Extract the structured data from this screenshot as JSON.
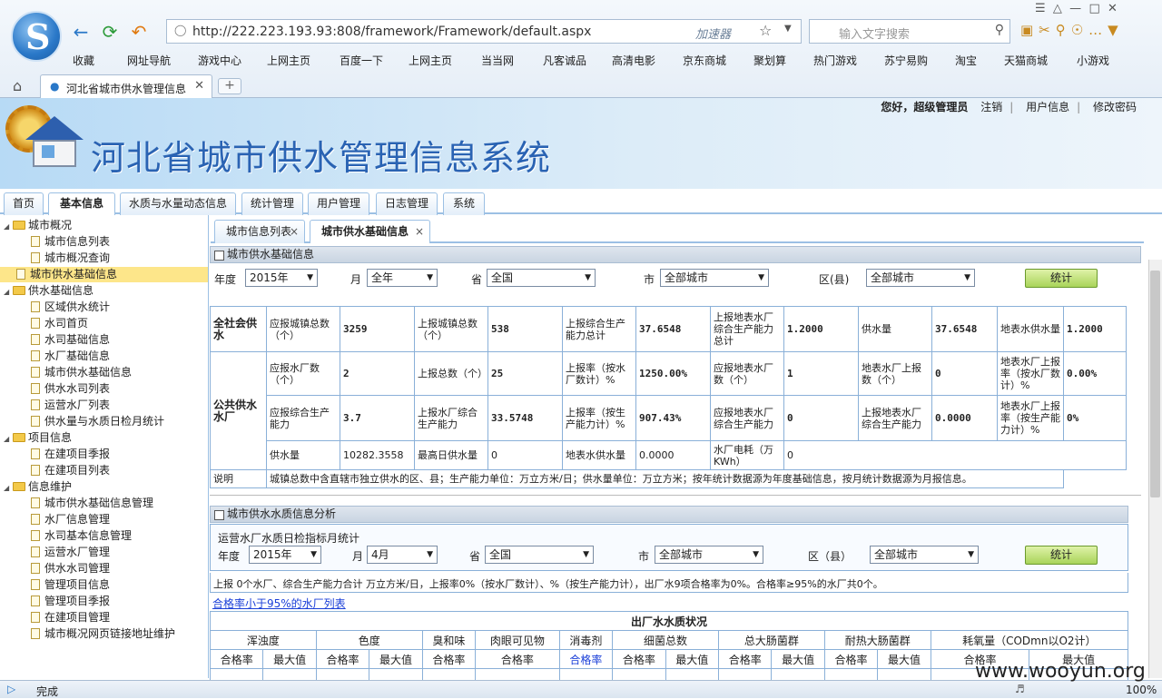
{
  "browser": {
    "url": "http://222.223.193.93:808/framework/Framework/default.aspx",
    "accelerator": "加速器",
    "search_placeholder": "输入文字搜索",
    "tab_title": "河北省城市供水管理信息",
    "status": "完成",
    "zoom": "100%"
  },
  "bookmarks": [
    "收藏",
    "网址导航",
    "游戏中心",
    "上网主页",
    "百度一下",
    "上网主页",
    "当当网",
    "凡客诚品",
    "高清电影",
    "京东商城",
    "聚划算",
    "热门游戏",
    "苏宁易购",
    "淘宝",
    "天猫商城",
    "小游戏"
  ],
  "app": {
    "title": "河北省城市供水管理信息系统",
    "greeting": "您好，超级管理员",
    "logout": "注销",
    "user_info": "用户信息",
    "change_pwd": "修改密码"
  },
  "main_tabs": [
    "首页",
    "基本信息",
    "水质与水量动态信息",
    "统计管理",
    "用户管理",
    "日志管理",
    "系统"
  ],
  "tree": [
    {
      "label": "城市概况",
      "lvl": 0,
      "type": "folder"
    },
    {
      "label": "城市信息列表",
      "lvl": 1,
      "type": "doc"
    },
    {
      "label": "城市概况查询",
      "lvl": 1,
      "type": "doc"
    },
    {
      "label": "城市供水基础信息",
      "lvl": 0,
      "type": "doc",
      "selected": true
    },
    {
      "label": "供水基础信息",
      "lvl": 0,
      "type": "folder"
    },
    {
      "label": "区域供水统计",
      "lvl": 1,
      "type": "doc"
    },
    {
      "label": "水司首页",
      "lvl": 1,
      "type": "doc"
    },
    {
      "label": "水司基础信息",
      "lvl": 1,
      "type": "doc"
    },
    {
      "label": "水厂基础信息",
      "lvl": 1,
      "type": "doc"
    },
    {
      "label": "城市供水基础信息",
      "lvl": 1,
      "type": "doc"
    },
    {
      "label": "供水水司列表",
      "lvl": 1,
      "type": "doc"
    },
    {
      "label": "运营水厂列表",
      "lvl": 1,
      "type": "doc"
    },
    {
      "label": "供水量与水质日检月统计",
      "lvl": 1,
      "type": "doc"
    },
    {
      "label": "项目信息",
      "lvl": 0,
      "type": "folder"
    },
    {
      "label": "在建项目季报",
      "lvl": 1,
      "type": "doc"
    },
    {
      "label": "在建项目列表",
      "lvl": 1,
      "type": "doc"
    },
    {
      "label": "信息维护",
      "lvl": 0,
      "type": "folder"
    },
    {
      "label": "城市供水基础信息管理",
      "lvl": 1,
      "type": "doc"
    },
    {
      "label": "水厂信息管理",
      "lvl": 1,
      "type": "doc"
    },
    {
      "label": "水司基本信息管理",
      "lvl": 1,
      "type": "doc"
    },
    {
      "label": "运营水厂管理",
      "lvl": 1,
      "type": "doc"
    },
    {
      "label": "供水水司管理",
      "lvl": 1,
      "type": "doc"
    },
    {
      "label": "管理项目信息",
      "lvl": 1,
      "type": "doc"
    },
    {
      "label": "管理项目季报",
      "lvl": 1,
      "type": "doc"
    },
    {
      "label": "在建项目管理",
      "lvl": 1,
      "type": "doc"
    },
    {
      "label": "城市概况网页链接地址维护",
      "lvl": 1,
      "type": "doc"
    }
  ],
  "content_tabs": [
    "城市信息列表",
    "城市供水基础信息"
  ],
  "p1": {
    "title": "城市供水基础信息",
    "f_year": "年度",
    "year": "2015年",
    "f_month": "月",
    "month": "全年",
    "f_prov": "省",
    "prov": "全国",
    "f_city": "市",
    "city": "全部城市",
    "f_county": "区(县)",
    "county": "全部城市",
    "btn": "统计",
    "r1": {
      "h": "全社会供水",
      "c": [
        "应报城镇总数（个）",
        "3259",
        "上报城镇总数（个）",
        "538",
        "上报综合生产能力总计",
        "37.6548",
        "上报地表水厂综合生产能力总计",
        "1.2000",
        "供水量",
        "37.6548",
        "地表水供水量",
        "1.2000"
      ]
    },
    "h2": "公共供水水厂",
    "r2": [
      "应报水厂数（个）",
      "2",
      "上报总数（个）",
      "25",
      "上报率（按水厂数计）%",
      "1250.00%",
      "应报地表水厂数（个）",
      "1",
      "地表水厂上报数（个）",
      "0",
      "地表水厂上报率（按水厂数计）%",
      "0.00%"
    ],
    "r3": [
      "应报综合生产能力",
      "3.7",
      "上报水厂综合生产能力",
      "33.5748",
      "上报率（按生产能力计）%",
      "907.43%",
      "应报地表水厂综合生产能力",
      "0",
      "上报地表水厂综合生产能力",
      "0.0000",
      "地表水厂上报率（按生产能力计）%",
      "0%"
    ],
    "r4": [
      "供水量",
      "10282.3558",
      "最高日供水量",
      "0",
      "地表水供水量",
      "0.0000",
      "水厂电耗（万KWh）",
      "0"
    ],
    "note_h": "说明",
    "note": "城镇总数中含直辖市独立供水的区、县；生产能力单位：万立方米/日；供水量单位：万立方米；按年统计数据源为年度基础信息，按月统计数据源为月报信息。"
  },
  "p2": {
    "title": "城市供水水质信息分析",
    "sub": "运营水厂水质日检指标月统计",
    "f_year": "年度",
    "year": "2015年",
    "f_month": "月",
    "month": "4月",
    "f_prov": "省",
    "prov": "全国",
    "f_city": "市",
    "city": "全部城市",
    "f_county": "区（县）",
    "county": "全部城市",
    "btn": "统计",
    "summary": "上报 0个水厂、综合生产能力合计 万立方米/日，上报率0%（按水厂数计）、%（按生产能力计），出厂水9项合格率为0%。合格率≥95%的水厂共0个。",
    "link": "合格率小于95%的水厂列表",
    "table_title": "出厂水水质状况",
    "groups": [
      "浑浊度",
      "色度",
      "臭和味",
      "肉眼可见物",
      "消毒剂",
      "细菌总数",
      "总大肠菌群",
      "耐热大肠菌群",
      "耗氧量（CODmn以O2计）"
    ],
    "subcols": [
      "合格率",
      "最大值",
      "合格率",
      "最大值",
      "合格率",
      "合格率",
      "合格率",
      "合格率",
      "最大值",
      "合格率",
      "最大值",
      "合格率",
      "最大值",
      "合格率",
      "最大值"
    ]
  },
  "watermark": "www.wooyun.org"
}
